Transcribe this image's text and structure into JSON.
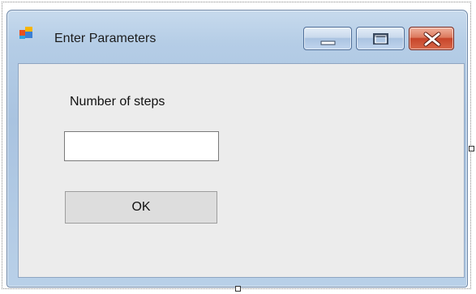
{
  "window": {
    "title": "Enter Parameters",
    "icon": "form-icon"
  },
  "caption_buttons": {
    "minimize_icon": "minimize-icon",
    "maximize_icon": "maximize-icon",
    "close_icon": "close-icon"
  },
  "form": {
    "steps_label": "Number of steps",
    "steps_value": "",
    "ok_label": "OK"
  },
  "colors": {
    "titlebar": "#b5cde6",
    "client_background": "#ececec",
    "close_button": "#c7452a"
  }
}
